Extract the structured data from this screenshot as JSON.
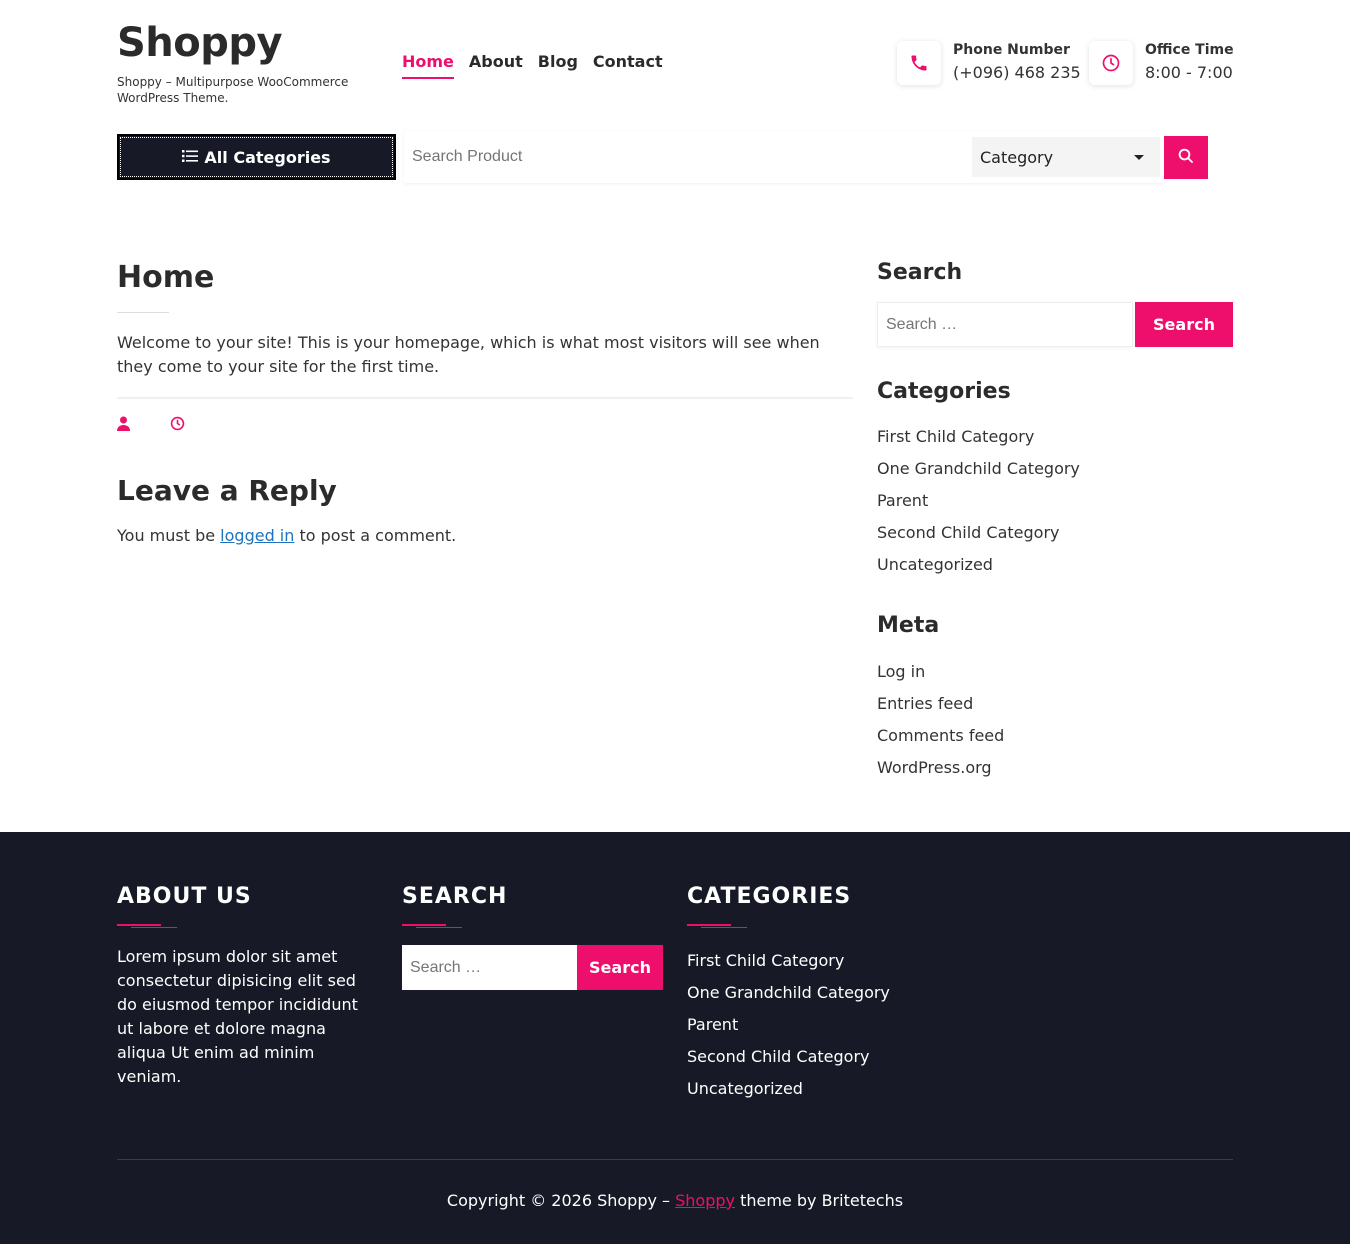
{
  "header": {
    "site_title": "Shoppy",
    "site_description": "Shoppy – Multipurpose WooCommerce WordPress Theme.",
    "nav": [
      {
        "label": "Home",
        "active": true
      },
      {
        "label": "About"
      },
      {
        "label": "Blog"
      },
      {
        "label": "Contact"
      }
    ],
    "phone_label": "Phone Number",
    "phone_value": "(+096) 468 235",
    "time_label": "Office Time",
    "time_value": "8:00 - 7:00",
    "phone_icon": "phone-icon",
    "time_icon": "clock-icon"
  },
  "searchbar": {
    "all_categories_label": "All Categories",
    "placeholder": "Search Product",
    "category_selected": "Category",
    "search_icon": "search-icon"
  },
  "main": {
    "title": "Home",
    "welcome": "Welcome to your site! This is your homepage, which is what most visitors will see when they come to your site for the first time.",
    "reply_title": "Leave a Reply",
    "reply_prefix": "You must be ",
    "reply_link": "logged in",
    "reply_suffix": " to post a comment."
  },
  "sidebar": {
    "search_title": "Search",
    "search_placeholder": "Search …",
    "search_button": "Search",
    "categories_title": "Categories",
    "categories": [
      "First Child Category",
      "One Grandchild Category",
      "Parent",
      "Second Child Category",
      "Uncategorized"
    ],
    "meta_title": "Meta",
    "meta": [
      "Log in",
      "Entries feed",
      "Comments feed",
      "WordPress.org"
    ]
  },
  "footer": {
    "about_title": "ABOUT US",
    "about_text": "Lorem ipsum dolor sit amet consectetur dipisicing elit sed do eiusmod tempor incididunt ut labore et dolore magna aliqua Ut enim ad minim veniam.",
    "search_title": "SEARCH",
    "search_placeholder": "Search …",
    "search_button": "Search",
    "categories_title": "CATEGORIES",
    "categories": [
      "First Child Category",
      "One Grandchild Category",
      "Parent",
      "Second Child Category",
      "Uncategorized"
    ],
    "copyright_prefix": "Copyright © 2026 Shoppy – ",
    "copyright_link": "Shoppy",
    "copyright_suffix": " theme by Britetechs"
  },
  "colors": {
    "accent": "#ee0e6b",
    "dark": "#171a26"
  }
}
